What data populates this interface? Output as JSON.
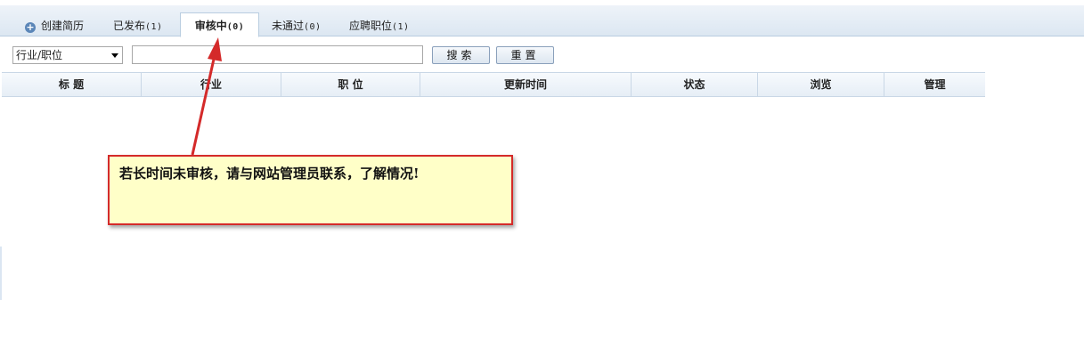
{
  "tabs": {
    "create": {
      "label": "创建简历"
    },
    "published": {
      "label": "已发布",
      "count": "(1)"
    },
    "reviewing": {
      "label": "审核中",
      "count": "(0)"
    },
    "rejected": {
      "label": "未通过",
      "count": "(0)"
    },
    "applied": {
      "label": "应聘职位",
      "count": "(1)"
    },
    "active": "reviewing"
  },
  "search": {
    "category_selected": "行业/职位",
    "keyword_value": "",
    "search_label": "搜索",
    "reset_label": "重置"
  },
  "table": {
    "columns": [
      "标 题",
      "行业",
      "职 位",
      "更新时间",
      "状态",
      "浏览",
      "管理"
    ]
  },
  "note": {
    "text": "若长时间未审核，请与网站管理员联系，了解情况!",
    "border_color": "#d42a2a",
    "background_color": "#ffffc8"
  },
  "icons": {
    "create": "plus-circle-icon",
    "select": "chevron-down-icon"
  }
}
